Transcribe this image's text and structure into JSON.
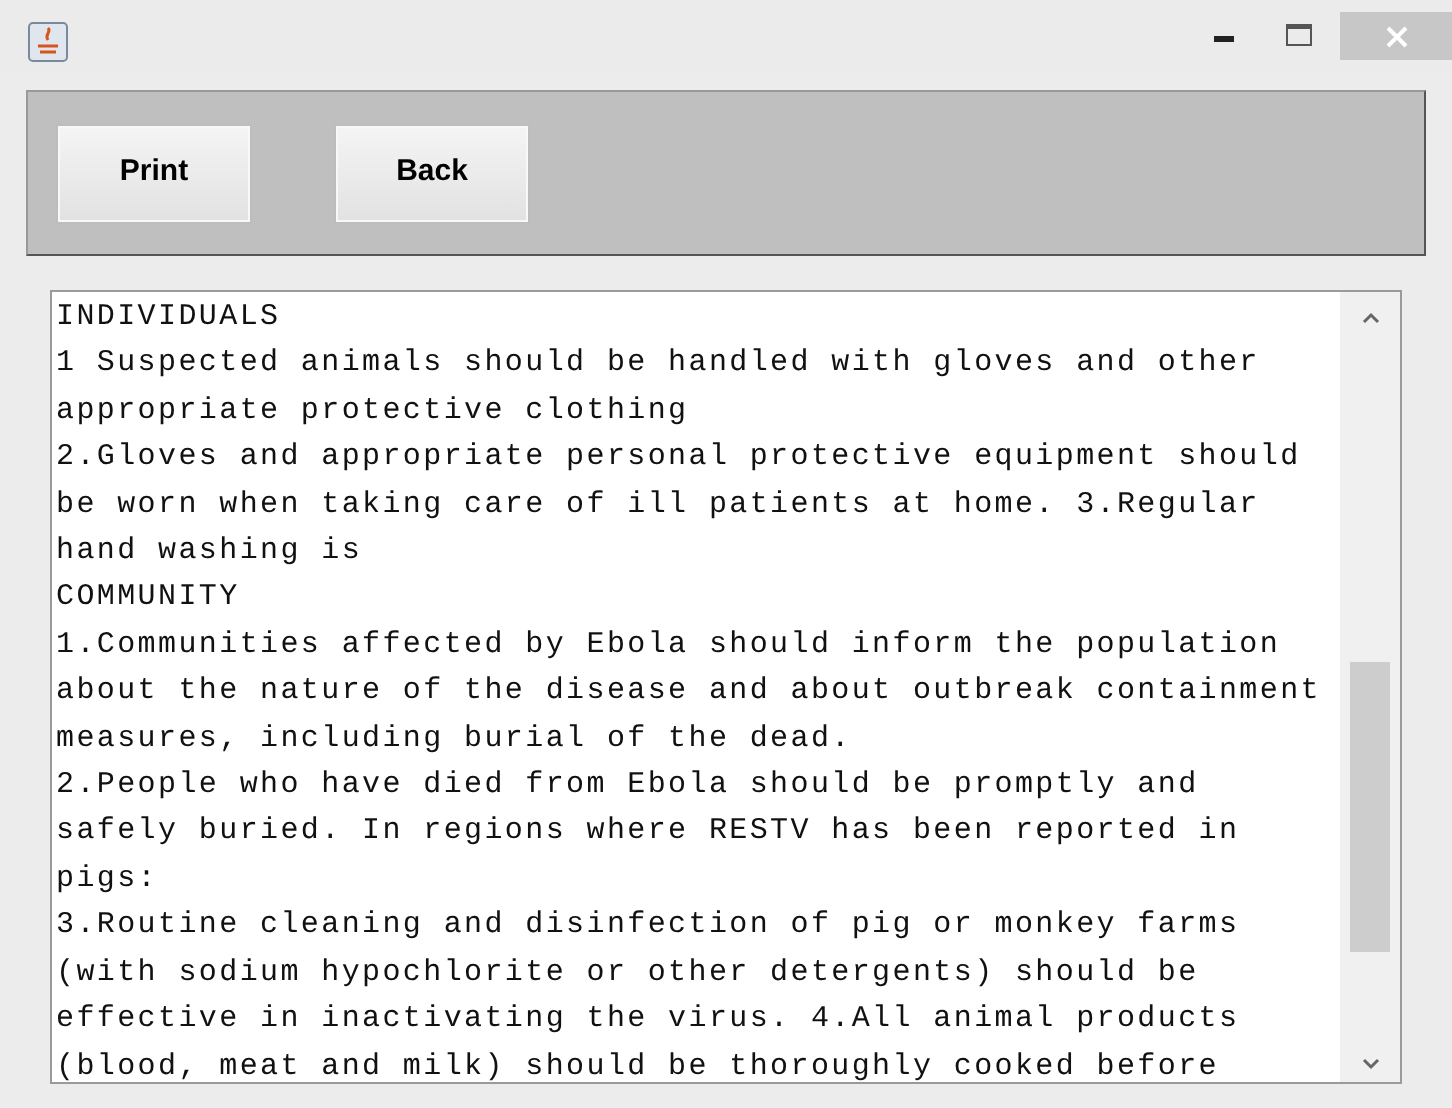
{
  "toolbar": {
    "buttons": [
      "Print",
      "Back"
    ]
  },
  "text_area": {
    "lines": [
      "INDIVIDUALS",
      "1 Suspected animals should be handled with gloves and other",
      "appropriate protective clothing",
      "2.Gloves and appropriate personal protective equipment should",
      "be worn when taking care of ill patients at home. 3.Regular",
      "hand washing is",
      "COMMUNITY",
      "1.Communities affected by Ebola should inform the population",
      "about the nature of the disease and about outbreak containment",
      "measures, including burial of the dead.",
      "2.People who have died from Ebola should be promptly and",
      "safely buried. In regions where RESTV has been reported in",
      "pigs:",
      "3.Routine cleaning and disinfection of pig or monkey farms",
      "(with sodium hypochlorite or other detergents) should be",
      "effective in inactivating the virus. 4.All animal products",
      "(blood, meat and milk) should be thoroughly cooked before"
    ]
  }
}
